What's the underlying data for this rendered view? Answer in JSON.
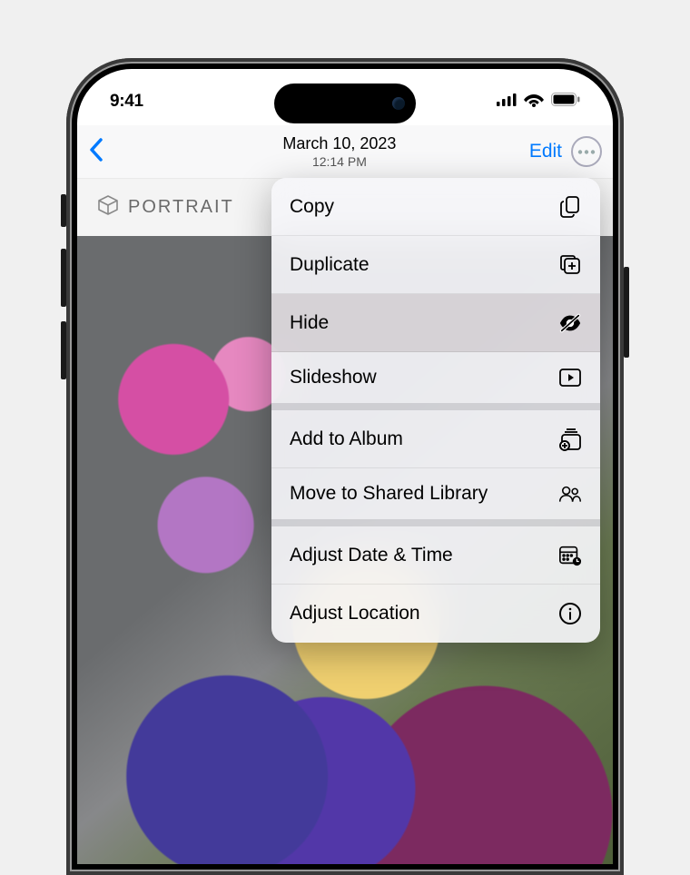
{
  "status": {
    "time": "9:41"
  },
  "nav": {
    "date": "March 10, 2023",
    "time": "12:14 PM",
    "edit": "Edit"
  },
  "badge": {
    "label": "PORTRAIT"
  },
  "menu": {
    "items": [
      {
        "label": "Copy",
        "icon": "copy-icon"
      },
      {
        "label": "Duplicate",
        "icon": "duplicate-icon"
      },
      {
        "label": "Hide",
        "icon": "hide-icon"
      },
      {
        "label": "Slideshow",
        "icon": "slideshow-icon"
      },
      {
        "label": "Add to Album",
        "icon": "add-album-icon"
      },
      {
        "label": "Move to Shared Library",
        "icon": "shared-library-icon"
      },
      {
        "label": "Adjust Date & Time",
        "icon": "calendar-icon"
      },
      {
        "label": "Adjust Location",
        "icon": "location-info-icon"
      }
    ]
  },
  "colors": {
    "accent": "#007aff"
  }
}
